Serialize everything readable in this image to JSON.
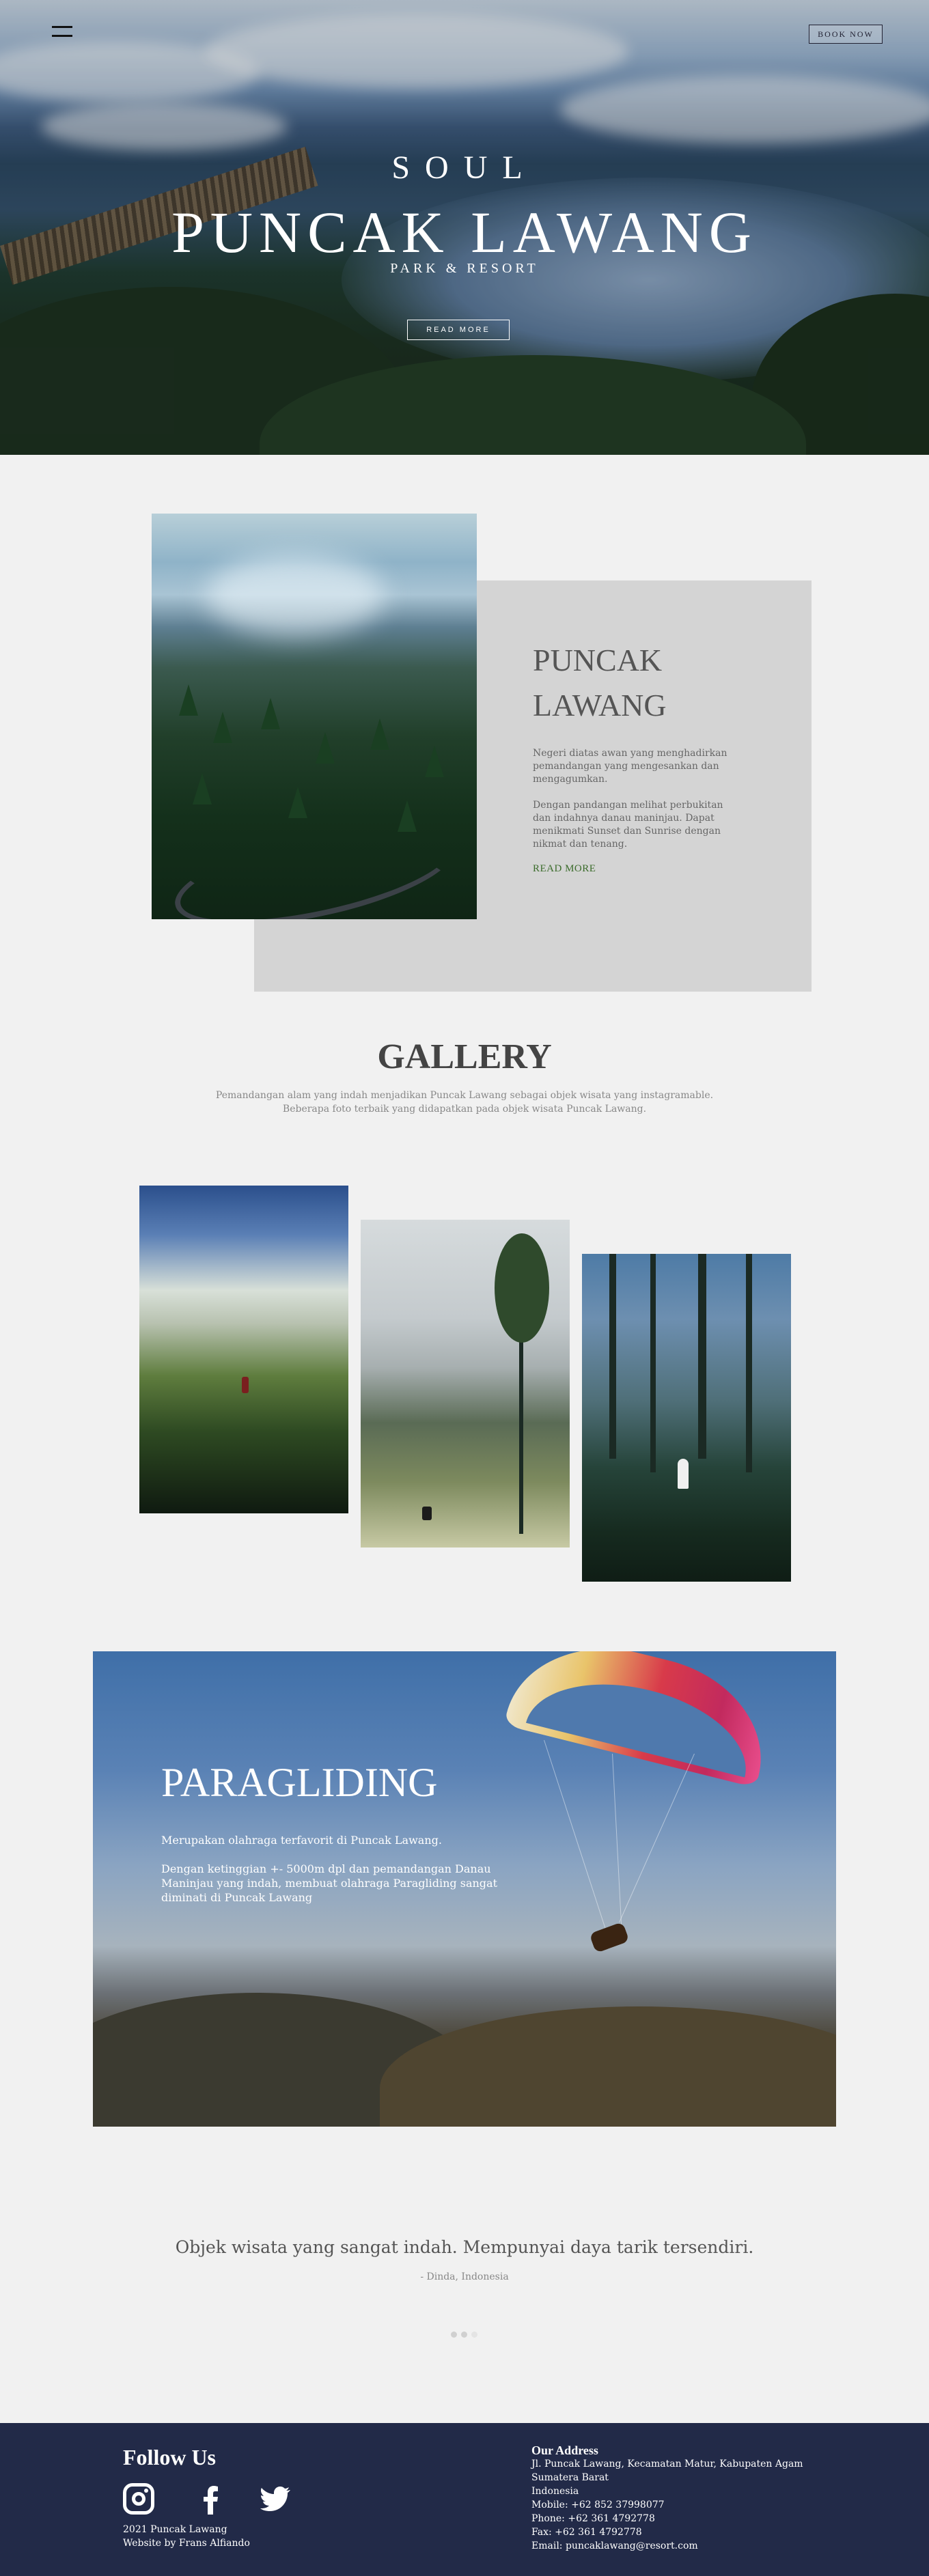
{
  "header": {
    "book_now": "BOOK NOW"
  },
  "hero": {
    "soul": "SOUL",
    "name": "PUNCAK LAWANG",
    "subtitle": "PARK & RESORT",
    "read_more": "READ MORE"
  },
  "about": {
    "title_line1": "PUNCAK",
    "title_line2": "LAWANG",
    "p1_line1": "Negeri diatas awan yang menghadirkan",
    "p1_line2": "pemandangan yang mengesankan dan",
    "p1_line3": "mengagumkan.",
    "p2_line1": "Dengan pandangan melihat perbukitan",
    "p2_line2": "dan indahnya danau maninjau. Dapat",
    "p2_line3": "menikmati Sunset dan Sunrise dengan",
    "p2_line4": "nikmat dan tenang.",
    "read_more": "READ MORE"
  },
  "gallery": {
    "title": "GALLERY",
    "desc_line1": "Pemandangan alam yang indah menjadikan Puncak Lawang sebagai objek wisata yang instagramable.",
    "desc_line2": "Beberapa foto terbaik yang didapatkan pada objek wisata Puncak Lawang."
  },
  "paragliding": {
    "title": "PARAGLIDING",
    "p1": "Merupakan olahraga terfavorit di Puncak Lawang.",
    "p2_line1": "Dengan ketinggian +- 5000m dpl dan pemandangan Danau",
    "p2_line2": "Maninjau yang indah, membuat olahraga Paragliding sangat",
    "p2_line3": "diminati di Puncak Lawang"
  },
  "testimonial": {
    "quote": "Objek wisata yang sangat indah. Mempunyai daya tarik tersendiri.",
    "author": "- Dinda, Indonesia"
  },
  "footer": {
    "follow_us": "Follow Us",
    "copyright": "2021 Puncak Lawang",
    "credit": "Website by Frans Alfiando",
    "address_title": "Our Address",
    "address_line1": "Jl. Puncak Lawang, Kecamatan Matur, Kabupaten Agam",
    "address_line2": "Sumatera Barat",
    "address_line3": "Indonesia",
    "mobile": "Mobile: +62 852 37998077",
    "phone": "Phone: +62 361 4792778",
    "fax": "Fax: +62 361 4792778",
    "email": "Email: puncaklawang@resort.com",
    "icons": [
      "instagram-icon",
      "facebook-icon",
      "twitter-icon"
    ]
  }
}
